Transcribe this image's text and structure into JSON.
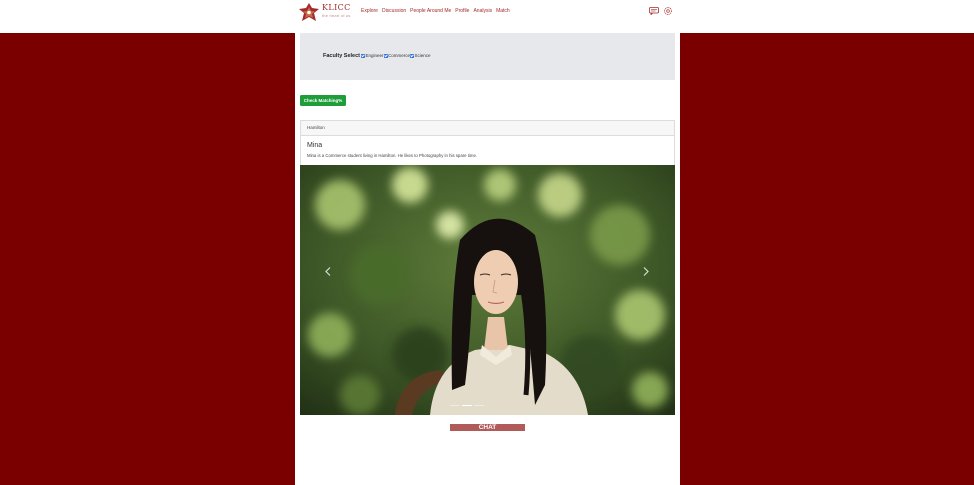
{
  "brand": {
    "title": "KLICC",
    "tagline": "the heart of us"
  },
  "nav": [
    {
      "label": "Explore"
    },
    {
      "label": "Discussion"
    },
    {
      "label": "People Around Me"
    },
    {
      "label": "Profile"
    },
    {
      "label": "Analysis"
    },
    {
      "label": "Match"
    }
  ],
  "header_icons": {
    "messages": "chat-bubble-icon",
    "settings": "gear-icon"
  },
  "faculty": {
    "label": "Faculty Select",
    "options": [
      {
        "label": "Engineer",
        "checked": true
      },
      {
        "label": "Commerce",
        "checked": true
      },
      {
        "label": "Science",
        "checked": true
      }
    ]
  },
  "check_button": "Check Matching%",
  "card": {
    "location": "Hamilton",
    "name": "Mina",
    "description": "Mina is a Commerce student living in Hamilton. He likes to Photography in his spare time."
  },
  "carousel": {
    "slide_count": 3,
    "active_slide": 1
  },
  "chat_button": "CHAT",
  "colors": {
    "brand_red": "#7a0000",
    "accent": "#a52a2a",
    "success": "#1e9e3a",
    "chat": "#b15a5a"
  }
}
